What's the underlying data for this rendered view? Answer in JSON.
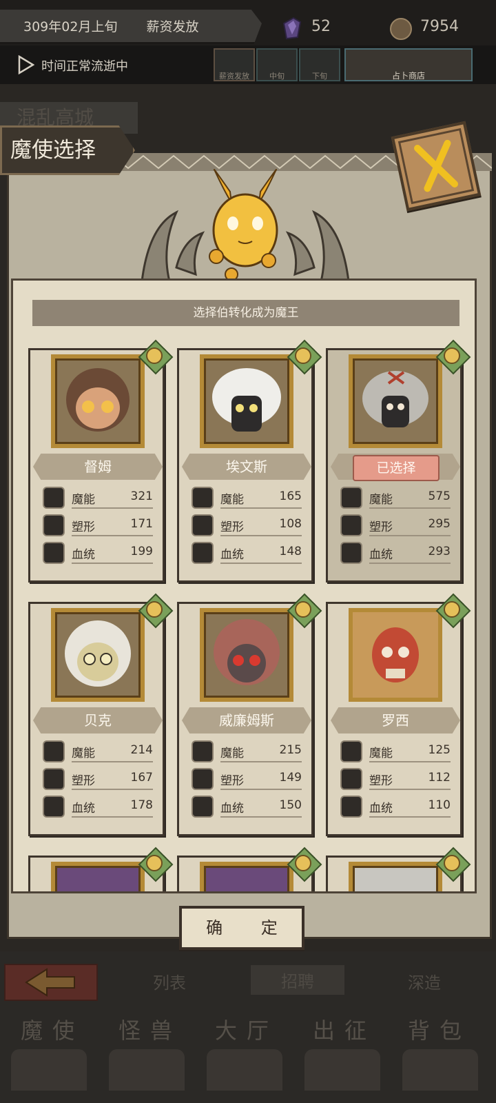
{
  "topbar": {
    "date": "309年02月上旬",
    "event": "薪资发放",
    "gems": "52",
    "coins": "7954"
  },
  "timebar": {
    "status": "时间正常流逝中",
    "phases": [
      "薪资发放",
      "中旬",
      "下旬"
    ],
    "shop": "占卜商店"
  },
  "background": {
    "title": "混乱高城"
  },
  "dialog": {
    "title": "魔使选择",
    "subtitle": "选择伯转化成为魔王",
    "confirm": "确 定",
    "stat_labels": [
      "魔能",
      "塑形",
      "血统"
    ],
    "selected_label": "已选择",
    "characters": [
      {
        "name": "督姆",
        "magic": "321",
        "shape": "171",
        "blood": "199",
        "selected": false
      },
      {
        "name": "埃文斯",
        "magic": "165",
        "shape": "108",
        "blood": "148",
        "selected": false
      },
      {
        "name": "",
        "magic": "575",
        "shape": "295",
        "blood": "293",
        "selected": true
      },
      {
        "name": "贝克",
        "magic": "214",
        "shape": "167",
        "blood": "178",
        "selected": false
      },
      {
        "name": "威廉姆斯",
        "magic": "215",
        "shape": "149",
        "blood": "150",
        "selected": false
      },
      {
        "name": "罗西",
        "magic": "125",
        "shape": "112",
        "blood": "110",
        "selected": false
      }
    ]
  },
  "bottom": {
    "subtabs": [
      "列表",
      "招聘",
      "深造"
    ],
    "nav": [
      "魔使",
      "怪兽",
      "大厅",
      "出征",
      "背包"
    ]
  },
  "colors": {
    "panel": "#b9b29f",
    "paper": "#e4dcc7",
    "frame_gold": "#b48a37",
    "selected_pink": "#e59b8a"
  }
}
